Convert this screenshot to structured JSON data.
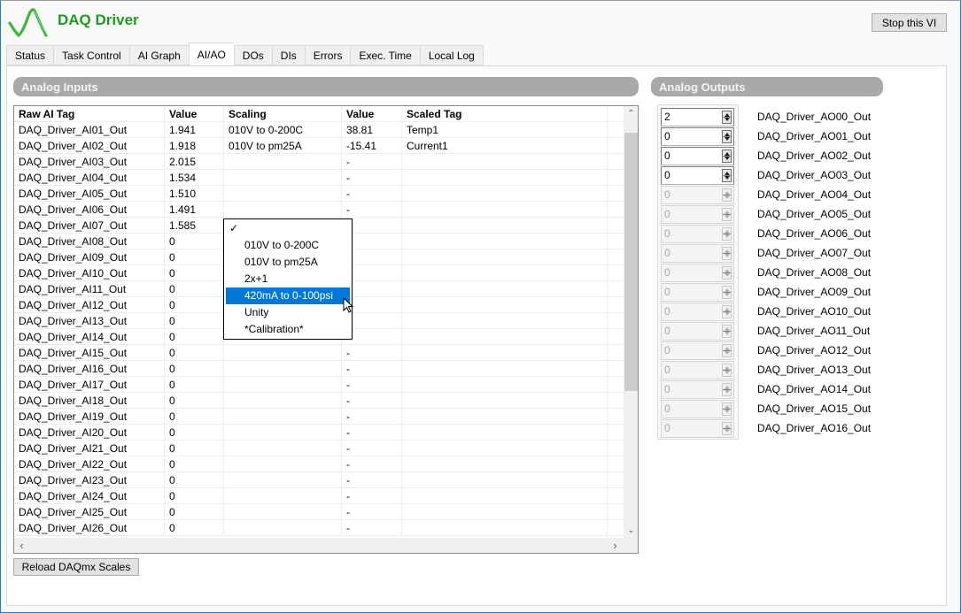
{
  "app": {
    "title": "DAQ Driver",
    "brand_color": "#1e9a1e",
    "stop_button_label": "Stop this VI"
  },
  "tabs": [
    {
      "label": "Status",
      "active": false
    },
    {
      "label": "Task Control",
      "active": false
    },
    {
      "label": "AI Graph",
      "active": false
    },
    {
      "label": "AI/AO",
      "active": true
    },
    {
      "label": "DOs",
      "active": false
    },
    {
      "label": "DIs",
      "active": false
    },
    {
      "label": "Errors",
      "active": false
    },
    {
      "label": "Exec. Time",
      "active": false
    },
    {
      "label": "Local Log",
      "active": false
    }
  ],
  "analog_inputs": {
    "title": "Analog Inputs",
    "columns": [
      "Raw AI Tag",
      "Value",
      "Scaling",
      "Value",
      "Scaled Tag"
    ],
    "rows": [
      [
        "DAQ_Driver_AI01_Out",
        "1.941",
        "010V to 0-200C",
        "38.81",
        "Temp1"
      ],
      [
        "DAQ_Driver_AI02_Out",
        "1.918",
        "010V to pm25A",
        "-15.41",
        "Current1"
      ],
      [
        "DAQ_Driver_AI03_Out",
        "2.015",
        "",
        "-",
        ""
      ],
      [
        "DAQ_Driver_AI04_Out",
        "1.534",
        "",
        "-",
        ""
      ],
      [
        "DAQ_Driver_AI05_Out",
        "1.510",
        "",
        "-",
        ""
      ],
      [
        "DAQ_Driver_AI06_Out",
        "1.491",
        "",
        "-",
        ""
      ],
      [
        "DAQ_Driver_AI07_Out",
        "1.585",
        "",
        "",
        ""
      ],
      [
        "DAQ_Driver_AI08_Out",
        "0",
        "",
        "",
        ""
      ],
      [
        "DAQ_Driver_AI09_Out",
        "0",
        "",
        "",
        ""
      ],
      [
        "DAQ_Driver_AI10_Out",
        "0",
        "",
        "",
        ""
      ],
      [
        "DAQ_Driver_AI11_Out",
        "0",
        "",
        "",
        ""
      ],
      [
        "DAQ_Driver_AI12_Out",
        "0",
        "",
        "",
        ""
      ],
      [
        "DAQ_Driver_AI13_Out",
        "0",
        "",
        "",
        ""
      ],
      [
        "DAQ_Driver_AI14_Out",
        "0",
        "",
        "",
        ""
      ],
      [
        "DAQ_Driver_AI15_Out",
        "0",
        "",
        "-",
        ""
      ],
      [
        "DAQ_Driver_AI16_Out",
        "0",
        "",
        "-",
        ""
      ],
      [
        "DAQ_Driver_AI17_Out",
        "0",
        "",
        "-",
        ""
      ],
      [
        "DAQ_Driver_AI18_Out",
        "0",
        "",
        "-",
        ""
      ],
      [
        "DAQ_Driver_AI19_Out",
        "0",
        "",
        "-",
        ""
      ],
      [
        "DAQ_Driver_AI20_Out",
        "0",
        "",
        "-",
        ""
      ],
      [
        "DAQ_Driver_AI21_Out",
        "0",
        "",
        "-",
        ""
      ],
      [
        "DAQ_Driver_AI22_Out",
        "0",
        "",
        "-",
        ""
      ],
      [
        "DAQ_Driver_AI23_Out",
        "0",
        "",
        "-",
        ""
      ],
      [
        "DAQ_Driver_AI24_Out",
        "0",
        "",
        "-",
        ""
      ],
      [
        "DAQ_Driver_AI25_Out",
        "0",
        "",
        "-",
        ""
      ],
      [
        "DAQ_Driver_AI26_Out",
        "0",
        "",
        "-",
        ""
      ]
    ],
    "reload_button_label": "Reload DAQmx Scales"
  },
  "scaling_dropdown": {
    "check_mark": "✓",
    "options": [
      "",
      "010V to 0-200C",
      "010V to pm25A",
      "2x+1",
      "420mA to 0-100psi",
      "Unity",
      "*Calibration*"
    ],
    "highlighted": "420mA to 0-100psi",
    "highlight_color": "#0078d7"
  },
  "analog_outputs": {
    "title": "Analog Outputs",
    "rows": [
      {
        "value": "2",
        "label": "DAQ_Driver_AO00_Out",
        "enabled": true
      },
      {
        "value": "0",
        "label": "DAQ_Driver_AO01_Out",
        "enabled": true
      },
      {
        "value": "0",
        "label": "DAQ_Driver_AO02_Out",
        "enabled": true
      },
      {
        "value": "0",
        "label": "DAQ_Driver_AO03_Out",
        "enabled": true
      },
      {
        "value": "0",
        "label": "DAQ_Driver_AO04_Out",
        "enabled": false
      },
      {
        "value": "0",
        "label": "DAQ_Driver_AO05_Out",
        "enabled": false
      },
      {
        "value": "0",
        "label": "DAQ_Driver_AO06_Out",
        "enabled": false
      },
      {
        "value": "0",
        "label": "DAQ_Driver_AO07_Out",
        "enabled": false
      },
      {
        "value": "0",
        "label": "DAQ_Driver_AO08_Out",
        "enabled": false
      },
      {
        "value": "0",
        "label": "DAQ_Driver_AO09_Out",
        "enabled": false
      },
      {
        "value": "0",
        "label": "DAQ_Driver_AO10_Out",
        "enabled": false
      },
      {
        "value": "0",
        "label": "DAQ_Driver_AO11_Out",
        "enabled": false
      },
      {
        "value": "0",
        "label": "DAQ_Driver_AO12_Out",
        "enabled": false
      },
      {
        "value": "0",
        "label": "DAQ_Driver_AO13_Out",
        "enabled": false
      },
      {
        "value": "0",
        "label": "DAQ_Driver_AO14_Out",
        "enabled": false
      },
      {
        "value": "0",
        "label": "DAQ_Driver_AO15_Out",
        "enabled": false
      },
      {
        "value": "0",
        "label": "DAQ_Driver_AO16_Out",
        "enabled": false
      }
    ]
  },
  "icons": {
    "logo": "waveform-logo-icon",
    "scroll_up": "chevron-up-icon",
    "scroll_down": "chevron-down-icon",
    "scroll_left": "chevron-left-icon",
    "scroll_right": "chevron-right-icon",
    "cursor": "mouse-pointer-icon"
  }
}
